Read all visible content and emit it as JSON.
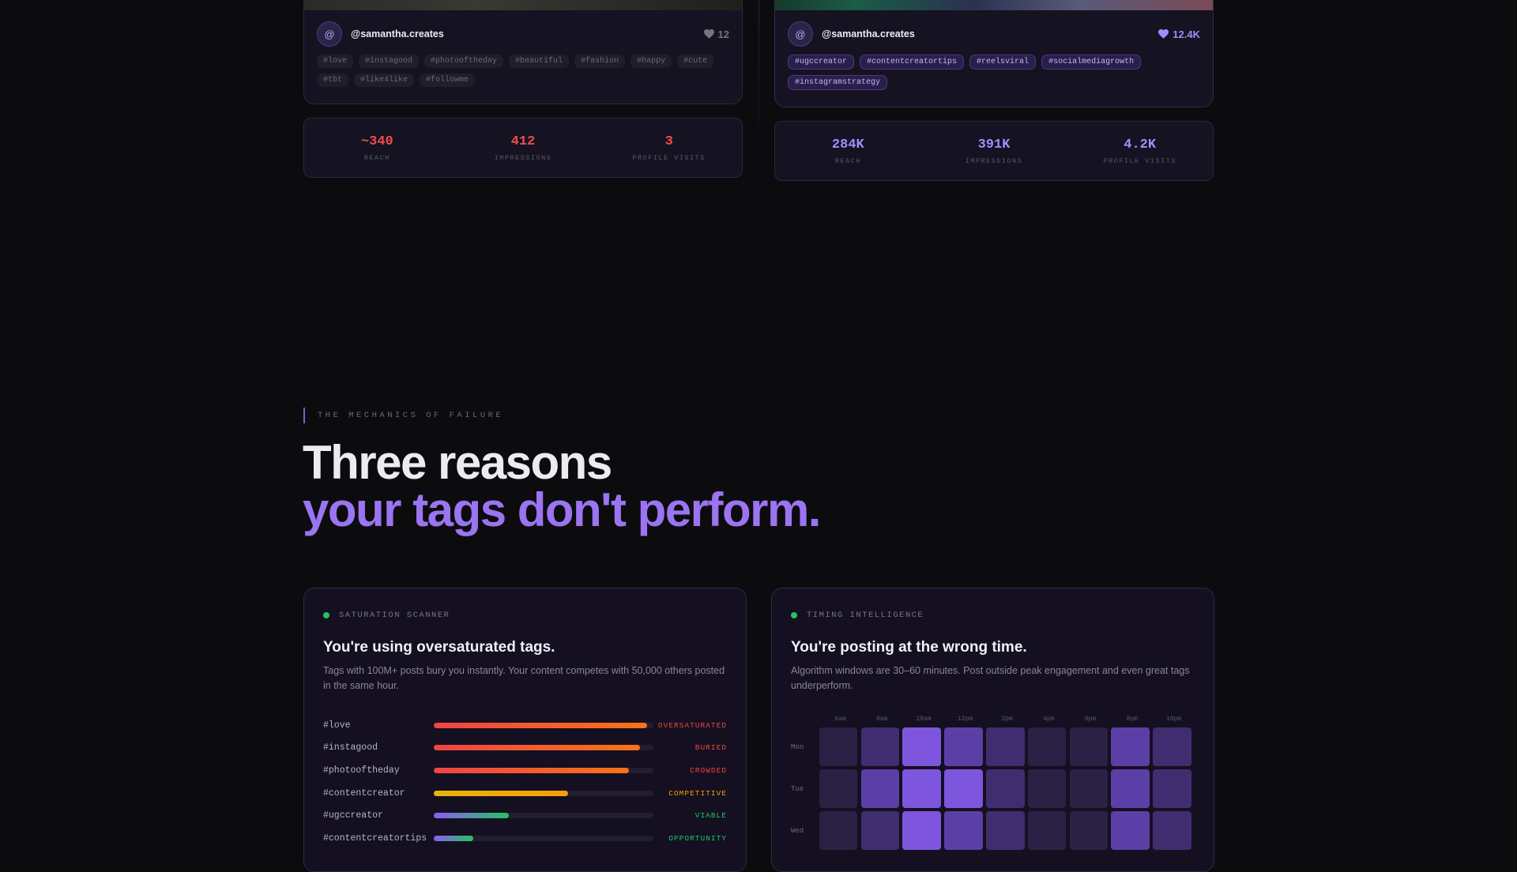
{
  "comparison": {
    "bad": {
      "handle": "@samantha.creates",
      "avatar_glyph": "@",
      "likes": "12",
      "heart_color": "#77737f",
      "tags": [
        "#love",
        "#instagood",
        "#photooftheday",
        "#beautiful",
        "#fashion",
        "#happy",
        "#cute",
        "#tbt",
        "#like4like",
        "#followme"
      ],
      "stats": [
        {
          "value": "~340",
          "label": "REACH"
        },
        {
          "value": "412",
          "label": "IMPRESSIONS"
        },
        {
          "value": "3",
          "label": "PROFILE VISITS"
        }
      ],
      "stat_color": "#ef4c4c"
    },
    "good": {
      "handle": "@samantha.creates",
      "avatar_glyph": "@",
      "likes": "12.4K",
      "heart_color": "#a78bfa",
      "tags": [
        "#ugccreator",
        "#contentcreatortips",
        "#reelsviral",
        "#socialmediagrowth",
        "#instagramstrategy"
      ],
      "stats": [
        {
          "value": "284K",
          "label": "REACH"
        },
        {
          "value": "391K",
          "label": "IMPRESSIONS"
        },
        {
          "value": "4.2K",
          "label": "PROFILE VISITS"
        }
      ],
      "stat_color": "#a78bfa"
    }
  },
  "section": {
    "eyebrow": "THE MECHANICS OF FAILURE",
    "headline_line1": "Three reasons",
    "headline_line2": "your tags don't perform."
  },
  "saturation": {
    "eyebrow": "SATURATION SCANNER",
    "title": "You're using oversaturated tags.",
    "description": "Tags with 100M+ posts bury you instantly. Your content competes with 50,000 others posted in the same hour.",
    "rows": [
      {
        "tag": "#love",
        "fill": 0.97,
        "status": "OVERSATURATED",
        "status_color": "#ef4444",
        "gradient": [
          "#ef4444",
          "#f97316"
        ]
      },
      {
        "tag": "#instagood",
        "fill": 0.94,
        "status": "BURIED",
        "status_color": "#ef4444",
        "gradient": [
          "#ef4444",
          "#f97316"
        ]
      },
      {
        "tag": "#photooftheday",
        "fill": 0.89,
        "status": "CROWDED",
        "status_color": "#ef4444",
        "gradient": [
          "#ef4444",
          "#f97316"
        ]
      },
      {
        "tag": "#contentcreator",
        "fill": 0.61,
        "status": "COMPETITIVE",
        "status_color": "#f59e0b",
        "gradient": [
          "#eab308",
          "#f59e0b"
        ]
      },
      {
        "tag": "#ugccreator",
        "fill": 0.34,
        "status": "VIABLE",
        "status_color": "#22c55e",
        "gradient": [
          "#8b5cf6",
          "#22c55e"
        ]
      },
      {
        "tag": "#contentcreatortips",
        "fill": 0.18,
        "status": "OPPORTUNITY",
        "status_color": "#22c55e",
        "gradient": [
          "#8b5cf6",
          "#22c55e"
        ]
      }
    ]
  },
  "timing": {
    "eyebrow": "TIMING INTELLIGENCE",
    "title": "You're posting at the wrong time.",
    "description": "Algorithm windows are 30–60 minutes. Post outside peak engagement and even great tags underperform.",
    "hours": [
      "6am",
      "8am",
      "10am",
      "12pm",
      "2pm",
      "4pm",
      "6pm",
      "8pm",
      "10pm"
    ],
    "days": [
      {
        "day": "Mon",
        "levels": [
          1,
          2,
          4,
          3,
          2,
          1,
          1,
          3,
          2
        ]
      },
      {
        "day": "Tue",
        "levels": [
          1,
          3,
          4,
          4,
          2,
          1,
          1,
          3,
          2
        ]
      },
      {
        "day": "Wed",
        "levels": [
          1,
          2,
          4,
          3,
          2,
          1,
          1,
          3,
          2
        ]
      }
    ],
    "level_colors": [
      "#1d1830",
      "#2a2145",
      "#402d6f",
      "#5c3fa6",
      "#7e55dd"
    ]
  }
}
